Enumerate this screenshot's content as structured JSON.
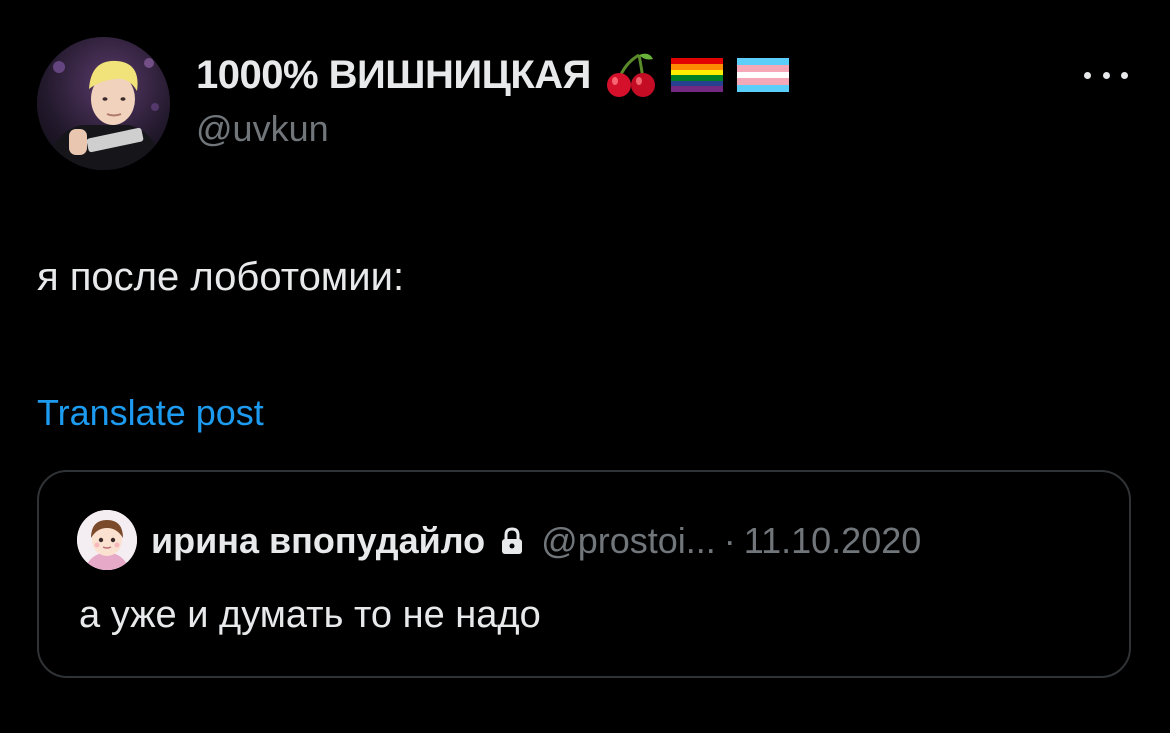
{
  "author": {
    "display_name": "1000% ВИШНИЦКАЯ",
    "handle": "@uvkun",
    "avatar_icon": "profile-photo",
    "badges": [
      "cherry-emoji",
      "rainbow-flag-emoji",
      "transgender-flag-emoji"
    ]
  },
  "menu": {
    "icon": "more-options-icon"
  },
  "post": {
    "text": "я после лоботомии:",
    "translate_label": "Translate post"
  },
  "quoted_post": {
    "display_name": "ирина впопудайло",
    "lock_icon": "lock-icon",
    "handle": "@prostoi...",
    "separator": "·",
    "date": "11.10.2020",
    "text": "а уже и думать то не надо"
  },
  "colors": {
    "background": "#000000",
    "text": "#e7e9ea",
    "secondary": "#71767b",
    "link": "#1d9bf0",
    "border": "#2f3336"
  }
}
